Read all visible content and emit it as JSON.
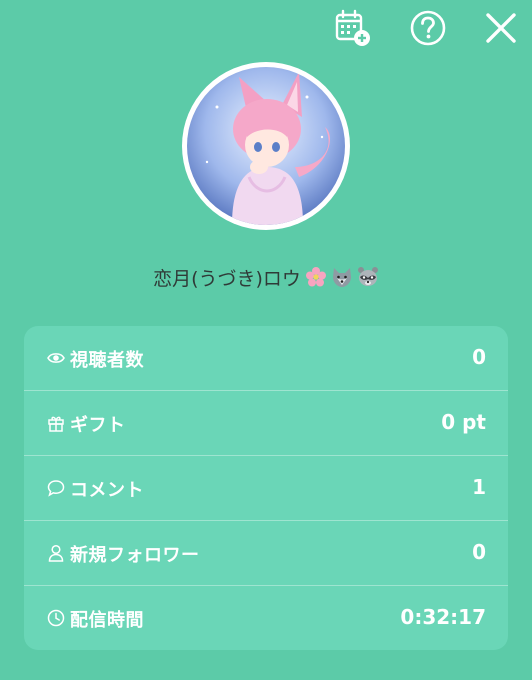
{
  "toolbar": {
    "icons": [
      "calendar-add-icon",
      "help-icon",
      "close-icon"
    ]
  },
  "profile": {
    "name": "恋月(うづき)ロウ",
    "emojis": [
      "cherry-blossom-icon",
      "wolf-icon",
      "raccoon-icon"
    ]
  },
  "stats": [
    {
      "icon": "eye-icon",
      "label": "視聴者数",
      "value": "0"
    },
    {
      "icon": "gift-icon",
      "label": "ギフト",
      "value": "0 pt"
    },
    {
      "icon": "comment-icon",
      "label": "コメント",
      "value": "1"
    },
    {
      "icon": "person-icon",
      "label": "新規フォロワー",
      "value": "0"
    },
    {
      "icon": "clock-icon",
      "label": "配信時間",
      "value": "0:32:17"
    }
  ],
  "colors": {
    "background": "#5ccba8",
    "card": "#6ad6b7",
    "text": "#ffffff",
    "name_text": "#2f3a37"
  }
}
